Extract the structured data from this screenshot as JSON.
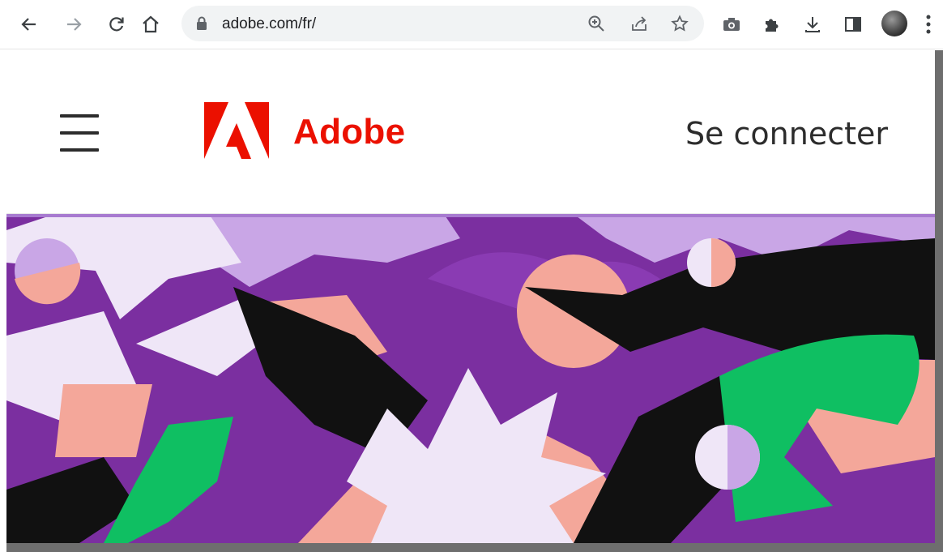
{
  "browser": {
    "url": "adobe.com/fr/",
    "icons": [
      "back-arrow-icon",
      "forward-arrow-icon",
      "reload-icon",
      "home-icon",
      "lock-icon",
      "zoom-icon",
      "share-icon",
      "bookmark-star-icon",
      "camera-extension-icon",
      "extensions-puzzle-icon",
      "download-icon",
      "side-panel-icon",
      "profile-avatar",
      "more-menu-icon"
    ]
  },
  "page": {
    "brand_name": "Adobe",
    "signin_label": "Se connecter",
    "brand_color": "#eb1000",
    "hero_palette": [
      "#7b2fa0",
      "#c9a6e6",
      "#f4a79a",
      "#0fbf62",
      "#111111",
      "#efe6f7"
    ]
  }
}
